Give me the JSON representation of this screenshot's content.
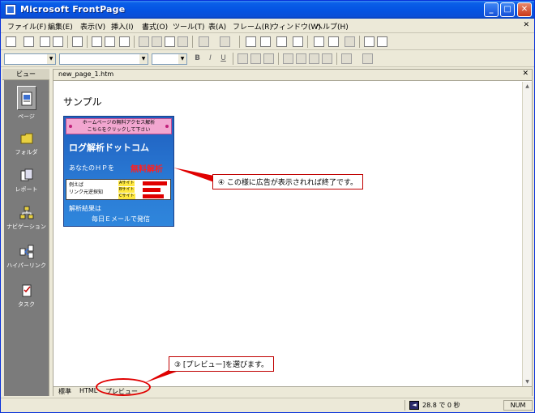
{
  "window": {
    "title": "Microsoft FrontPage"
  },
  "menubar": {
    "items": [
      "ファイル(F)",
      "編集(E)",
      "表示(V)",
      "挿入(I)",
      "書式(O)",
      "ツール(T)",
      "表(A)",
      "フレーム(R)",
      "ウィンドウ(W)",
      "ヘルプ(H)"
    ],
    "close_glyph": "✕"
  },
  "formatting": {
    "bold": "B",
    "italic": "I",
    "underline": "U"
  },
  "views": {
    "header": "ビュー",
    "items": [
      {
        "label": "ページ",
        "icon": "page-icon",
        "active": true
      },
      {
        "label": "フォルダ",
        "icon": "folder-icon"
      },
      {
        "label": "レポート",
        "icon": "report-icon"
      },
      {
        "label": "ナビゲーション",
        "icon": "navigation-icon"
      },
      {
        "label": "ハイパーリンク",
        "icon": "hyperlink-icon"
      },
      {
        "label": "タスク",
        "icon": "task-icon"
      }
    ]
  },
  "document": {
    "tab_name": "new_page_1.htm",
    "heading": "サンプル",
    "banner": {
      "top_line1": "ホームページの無料アクセス解析",
      "top_line2": "こちらをクリックして下さい",
      "title": "ログ解析ドットコム",
      "hp_text": "あなたのＨＰを",
      "free_text": "無料解析",
      "example_line1": "例えば",
      "example_line2": "リンク元逆探知",
      "site_a": "Aサイト",
      "site_b": "Bサイト",
      "site_c": "Cサイト",
      "result_line1": "解析結果は",
      "result_line2": "毎日Ｅメールで発信"
    }
  },
  "annotations": {
    "callout4": "④ この様に広告が表示されれば終了です。",
    "callout3": "③ [プレビュー]を選びます。"
  },
  "bottom_tabs": [
    "標準",
    "HTML",
    "プレビュー"
  ],
  "status": {
    "time": "28.8 で 0 秒",
    "num": "NUM"
  },
  "colors": {
    "accent_red": "#e00000",
    "title_blue": "#0554e3",
    "view_gray": "#7b7b7b"
  }
}
